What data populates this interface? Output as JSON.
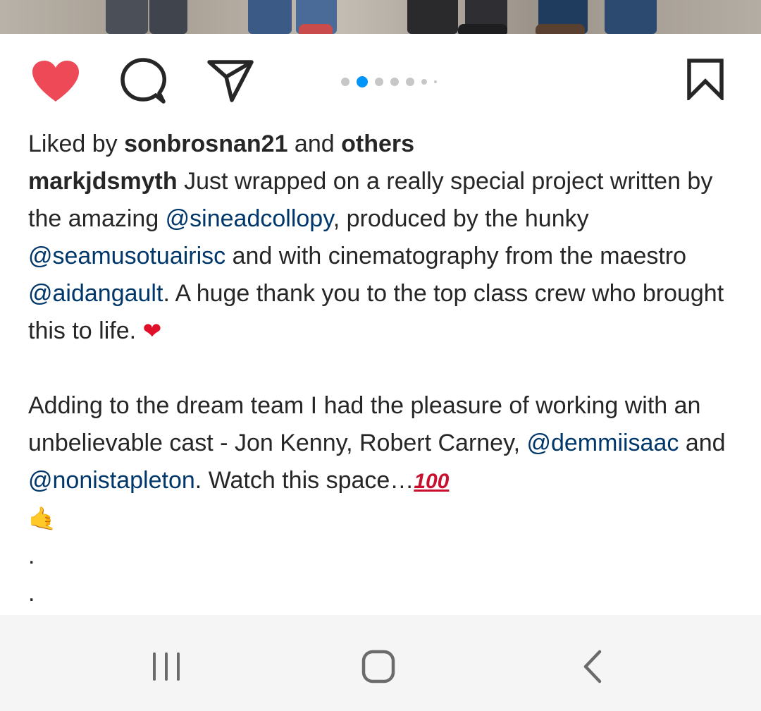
{
  "post": {
    "carousel": {
      "total": 7,
      "active_index": 1
    },
    "icons": {
      "like": "heart-filled-icon",
      "comment": "comment-bubble-icon",
      "share": "paper-plane-icon",
      "save": "bookmark-icon"
    },
    "colors": {
      "heart": "#ed4956",
      "mention": "#00376b",
      "text": "#262626",
      "active_dot": "#0095f6"
    },
    "likes": {
      "prefix": "Liked by ",
      "user": "sonbrosnan21",
      "middle": " and ",
      "others": "others"
    },
    "caption": {
      "username": "markjdsmyth",
      "p1_a": " Just wrapped on a really special project written by the amazing ",
      "m1": "@sineadcollopy",
      "p1_b": ", produced by the hunky ",
      "m2": "@seamusotuairisc",
      "p1_c": " and with cinematography from the maestro ",
      "m3": "@aidangault",
      "p1_d": ". A huge thank you to the top class crew who brought this to life. ",
      "emoji1": "❤",
      "p2_a": "Adding to the dream team I had the pleasure of working with an unbelievable cast - Jon Kenny, Robert Carney, ",
      "m4": "@demmiisaac",
      "p2_b": " and ",
      "m5": "@nonistapleton",
      "p2_c": ". Watch this space…",
      "emoji2": "100",
      "emoji3": "🤙",
      "dot1": ".",
      "dot2": "."
    }
  },
  "navbar": {
    "icons": {
      "recents": "recent-apps-icon",
      "home": "home-icon",
      "back": "back-chevron-icon"
    }
  }
}
